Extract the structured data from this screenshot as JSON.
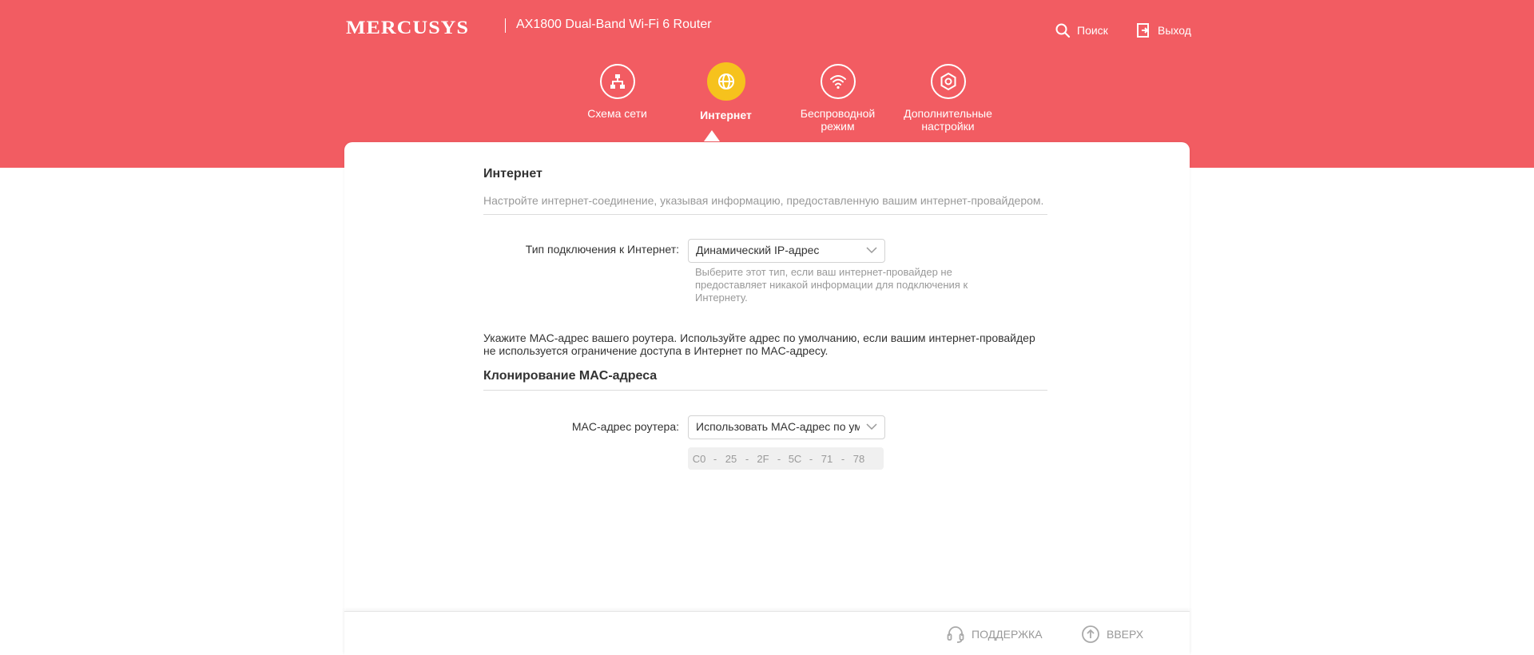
{
  "header": {
    "brand": "MERCUSYS",
    "model": "AX1800 Dual-Band Wi-Fi 6 Router",
    "search_label": "Поиск",
    "logout_label": "Выход",
    "accent_color": "#f25c62",
    "active_color": "#f6c21d"
  },
  "nav": {
    "items": [
      {
        "label_line1": "Схема сети",
        "label_line2": "",
        "icon": "network-map-icon"
      },
      {
        "label_line1": "Интернет",
        "label_line2": "",
        "icon": "globe-icon",
        "active": true
      },
      {
        "label_line1": "Беспроводной",
        "label_line2": "режим",
        "icon": "wifi-icon"
      },
      {
        "label_line1": "Дополнительные",
        "label_line2": "настройки",
        "icon": "settings-gear-icon"
      }
    ]
  },
  "internet": {
    "title": "Интернет",
    "description": "Настройте интернет-соединение, указывая информацию, предоставленную вашим интернет-провайдером.",
    "connection_type_label": "Тип подключения к Интернет:",
    "connection_type_value": "Динамический IP-адрес",
    "hint_line1": "Выберите этот тип, если ваш интернет-провайдер не",
    "hint_line2": "предоставляет никакой информации для подключения к",
    "hint_line3": "Интернету."
  },
  "mac_clone": {
    "notice_line1": "Укажите MAC-адрес вашего роутера. Используйте адрес по умолчанию, если вашим интернет-провайдер",
    "notice_line2": "не используется ограничение доступа в Интернет по MAC-адресу.",
    "title": "Клонирование MAC-адреса",
    "router_mac_label": "MAC-адрес роутера:",
    "router_mac_mode": "Использовать MAC-адрес по умолчанию",
    "mac_octets": [
      "C0",
      "25",
      "2F",
      "5C",
      "71",
      "78"
    ],
    "separator": "-"
  },
  "footer": {
    "support_label": "ПОДДЕРЖКА",
    "top_label": "ВВЕРХ"
  }
}
